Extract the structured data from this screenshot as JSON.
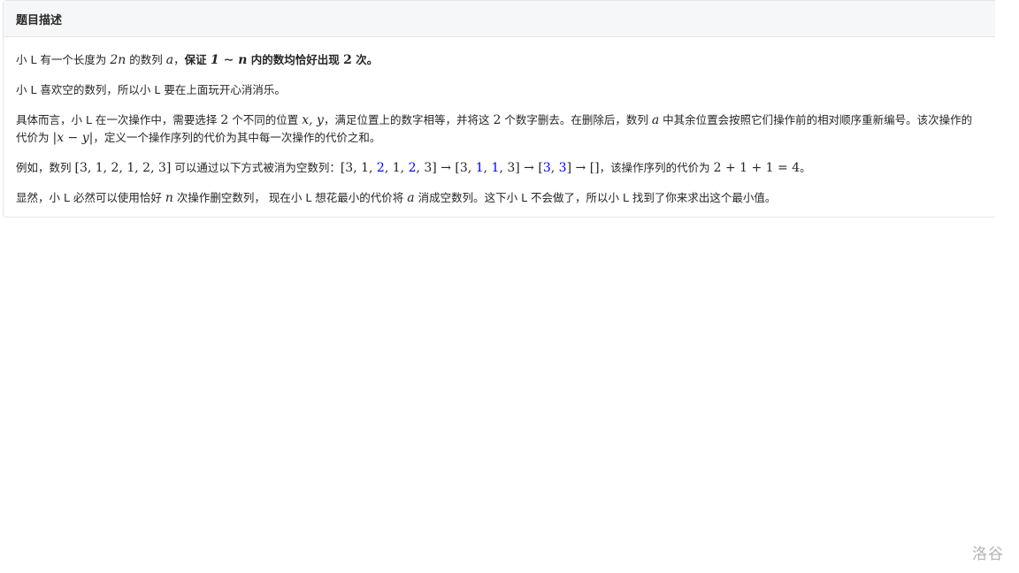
{
  "problem": {
    "section_title": "题目描述",
    "p1": {
      "t1": "小 L 有一个长度为 ",
      "m1": "2n",
      "t2": " 的数列 ",
      "m2": "a",
      "t3": "，",
      "b1": "保证 ",
      "bm1": "1 ∼ n",
      "b2": " 内的数均恰好出现 ",
      "bm2": "2",
      "b3": " 次。"
    },
    "p2": "小 L 喜欢空的数列，所以小 L 要在上面玩开心消消乐。",
    "p3": {
      "t1": "具体而言，小 L 在一次操作中，需要选择 ",
      "m1": "2",
      "t2": " 个不同的位置 ",
      "m2": "x, y",
      "t3": "，满足位置上的数字相等，并将这 ",
      "m3": "2",
      "t4": " 个数字删去。在删除后，数列 ",
      "m4": "a",
      "t5": " 中其余位置会按照它们操作前的相对顺序重新编号。该次操作的代价为 ",
      "m5": "|x − y|",
      "t6": "，定义一个操作序列的代价为其中每一次操作的代价之和。"
    },
    "p4": {
      "t1": "例如，数列 ",
      "m1": "[3, 1, 2, 1, 2, 3]",
      "t2": " 可以通过以下方式被消为空数列：",
      "s1a": "[3, 1, ",
      "s1b": "2",
      "s1c": ", 1, ",
      "s1d": "2",
      "s1e": ", 3]",
      "arrow1": " → ",
      "s2a": "[3, ",
      "s2b": "1",
      "s2c": ", ",
      "s2d": "1",
      "s2e": ", 3]",
      "arrow2": " → ",
      "s3a": "[",
      "s3b": "3",
      "s3c": ", ",
      "s3d": "3",
      "s3e": "]",
      "arrow3": " → ",
      "s4": "[]",
      "t3": "，该操作序列的代价为 ",
      "m2": "2 + 1 + 1 = 4",
      "t4": "。"
    },
    "p5": {
      "t1": "显然，小 L 必然可以使用恰好 ",
      "m1": "n",
      "t2": " 次操作删空数列， 现在小 L 想花最小的代价将 ",
      "m2": "a",
      "t3": " 消成空数列。这下小 L 不会做了，所以小 L 找到了你来求出这个最小值。"
    }
  },
  "watermark": "洛谷",
  "colors": {
    "highlight": "#0000ff",
    "header_bg": "#f6f7f8",
    "border": "#e6e6e6",
    "watermark": "#b3b3b3"
  }
}
